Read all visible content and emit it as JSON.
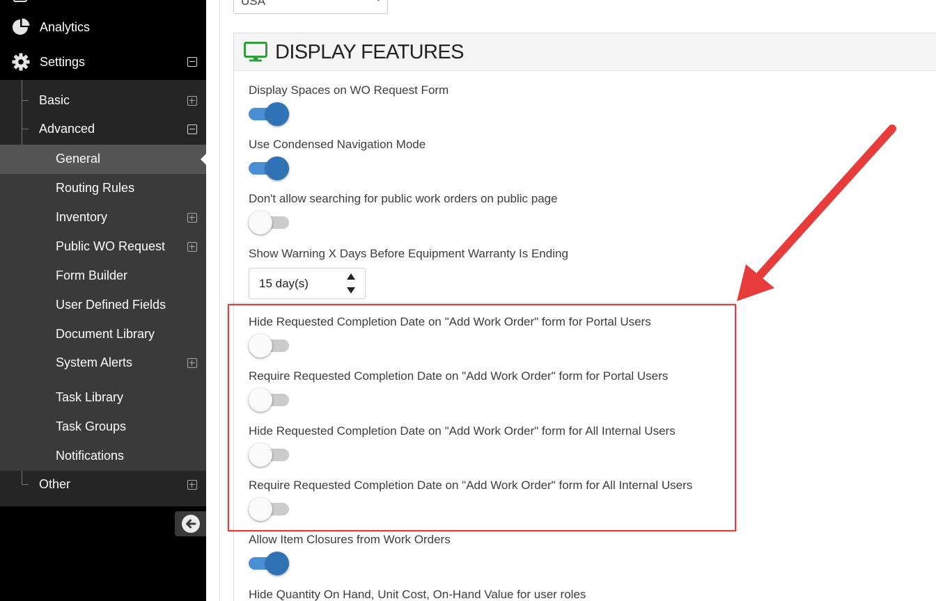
{
  "sidebar": {
    "analytics_label": "Analytics",
    "settings_label": "Settings",
    "level1": {
      "basic": "Basic",
      "advanced": "Advanced",
      "other": "Other"
    },
    "advanced_items": [
      "General",
      "Routing Rules",
      "Inventory",
      "Public WO Request",
      "Form Builder",
      "User Defined Fields",
      "Document Library",
      "System Alerts",
      "Task Library",
      "Task Groups",
      "Notifications"
    ],
    "active_item": "General"
  },
  "main": {
    "country_value": "USA",
    "panel_title": "DISPLAY FEATURES",
    "settings": [
      {
        "label": "Display Spaces on WO Request Form",
        "enabled": true
      },
      {
        "label": "Use Condensed Navigation Mode",
        "enabled": true
      },
      {
        "label": "Don't allow searching for public work orders on public page",
        "enabled": false
      },
      {
        "label": "Show Warning X Days Before Equipment Warranty Is Ending",
        "value": "15 day(s)"
      },
      {
        "label": "Hide Requested Completion Date on \"Add Work Order\" form for Portal Users",
        "enabled": false
      },
      {
        "label": "Require Requested Completion Date on \"Add Work Order\" form for Portal Users",
        "enabled": false
      },
      {
        "label": "Hide Requested Completion Date on \"Add Work Order\" form for All Internal Users",
        "enabled": false
      },
      {
        "label": "Require Requested Completion Date on \"Add Work Order\" form for All Internal Users",
        "enabled": false
      },
      {
        "label": "Allow Item Closures from Work Orders",
        "enabled": true
      },
      {
        "label": "Hide Quantity On Hand, Unit Cost, On-Hand Value for user roles"
      }
    ]
  },
  "colors": {
    "sidebar_bg": "#000000",
    "submenu_bg": "#252525",
    "active_bg": "#555555",
    "toggle_on": "#2f73b5",
    "annotation": "#e63c3c",
    "monitor_icon": "#2e9e3a"
  }
}
